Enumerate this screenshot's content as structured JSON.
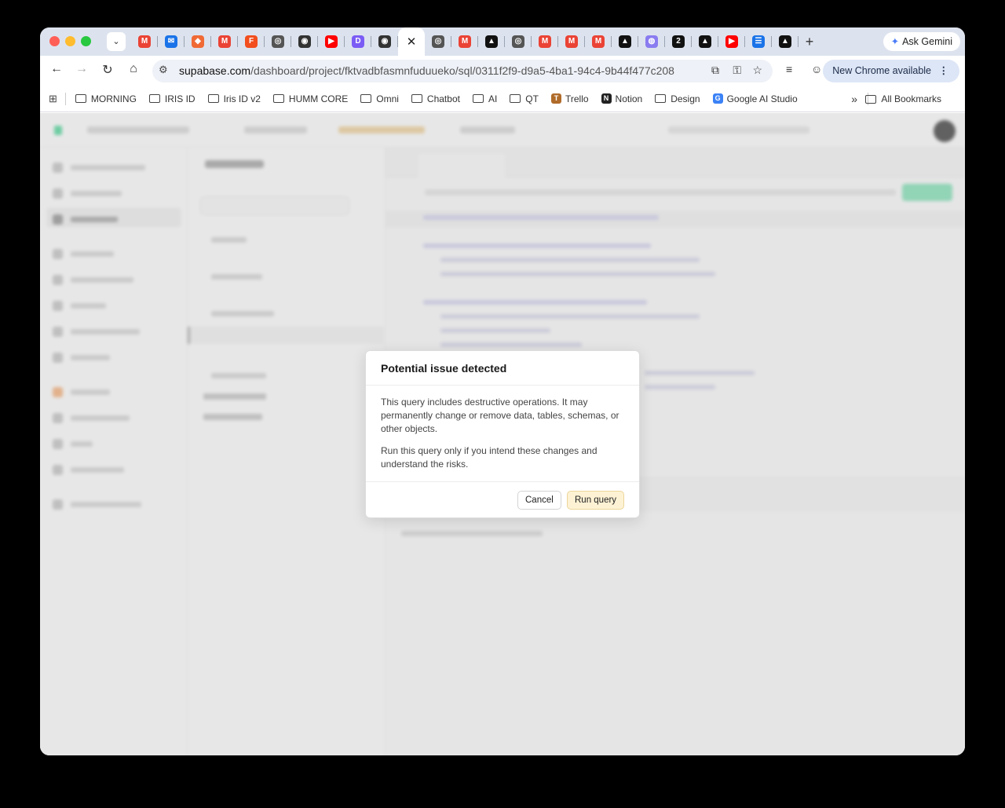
{
  "browser": {
    "tab_search_glyph": "⌄",
    "new_tab_glyph": "+",
    "active_tab_close": "✕",
    "ask_gemini": "Ask Gemini",
    "url_host": "supabase.com",
    "url_path": "/dashboard/project/fktvadbfasmnfuduueko/sql/0311f2f9-d9a5-4ba1-94c4-9b44f477c208",
    "new_chrome": "New Chrome available",
    "tabs": [
      {
        "icon": "gmail-icon",
        "color": "#ea4335",
        "glyph": "M"
      },
      {
        "icon": "mail-icon",
        "color": "#1a73e8",
        "glyph": "✉"
      },
      {
        "icon": "app-icon",
        "color": "#f06a35",
        "glyph": "◆"
      },
      {
        "icon": "gmail-icon",
        "color": "#ea4335",
        "glyph": "M"
      },
      {
        "icon": "figma-icon",
        "color": "#f24e1e",
        "glyph": "F"
      },
      {
        "icon": "web-icon",
        "color": "#555555",
        "glyph": "◎"
      },
      {
        "icon": "openai-icon",
        "color": "#333333",
        "glyph": "◉"
      },
      {
        "icon": "youtube-icon",
        "color": "#ff0000",
        "glyph": "▶"
      },
      {
        "icon": "d-icon",
        "color": "#7b5cf5",
        "glyph": "D"
      },
      {
        "icon": "openai-icon",
        "color": "#333333",
        "glyph": "◉"
      },
      {
        "icon": "active-tab",
        "color": "#ffffff",
        "glyph": "✕"
      },
      {
        "icon": "web-icon",
        "color": "#555555",
        "glyph": "◎"
      },
      {
        "icon": "gmail-icon",
        "color": "#ea4335",
        "glyph": "M"
      },
      {
        "icon": "vercel-icon",
        "color": "#111111",
        "glyph": "▲"
      },
      {
        "icon": "web-icon",
        "color": "#555555",
        "glyph": "◎"
      },
      {
        "icon": "gmail-icon",
        "color": "#ea4335",
        "glyph": "M"
      },
      {
        "icon": "gmail-icon",
        "color": "#ea4335",
        "glyph": "M"
      },
      {
        "icon": "gmail-icon",
        "color": "#ea4335",
        "glyph": "M"
      },
      {
        "icon": "vercel-icon",
        "color": "#111111",
        "glyph": "▲"
      },
      {
        "icon": "app-icon",
        "color": "#8a7cf0",
        "glyph": "◍"
      },
      {
        "icon": "app-icon",
        "color": "#111111",
        "glyph": "2"
      },
      {
        "icon": "vercel-icon",
        "color": "#111111",
        "glyph": "▲"
      },
      {
        "icon": "youtube-icon",
        "color": "#ff0000",
        "glyph": "▶"
      },
      {
        "icon": "sheets-icon",
        "color": "#1a73e8",
        "glyph": "☰"
      },
      {
        "icon": "vercel-icon",
        "color": "#111111",
        "glyph": "▲"
      }
    ]
  },
  "bookmarks": [
    {
      "label": "MORNING",
      "type": "folder"
    },
    {
      "label": "IRIS ID",
      "type": "folder"
    },
    {
      "label": "Iris ID v2",
      "type": "folder"
    },
    {
      "label": "HUMM CORE",
      "type": "folder"
    },
    {
      "label": "Omni",
      "type": "folder"
    },
    {
      "label": "Chatbot",
      "type": "folder"
    },
    {
      "label": "AI",
      "type": "folder"
    },
    {
      "label": "QT",
      "type": "folder"
    },
    {
      "label": "Trello",
      "type": "site",
      "color": "#b06b2a",
      "glyph": "T"
    },
    {
      "label": "Notion",
      "type": "site",
      "color": "#222222",
      "glyph": "N"
    },
    {
      "label": "Design",
      "type": "folder"
    },
    {
      "label": "Google AI Studio",
      "type": "site",
      "color": "#3b82f6",
      "glyph": "G"
    }
  ],
  "bookmarks_more": "»",
  "all_bookmarks": "All Bookmarks",
  "dialog": {
    "title": "Potential issue detected",
    "paragraph1": "This query includes destructive operations. It may permanently change or remove data, tables, schemas, or other objects.",
    "paragraph2": "Run this query only if you intend these changes and understand the risks.",
    "cancel": "Cancel",
    "run": "Run query"
  }
}
